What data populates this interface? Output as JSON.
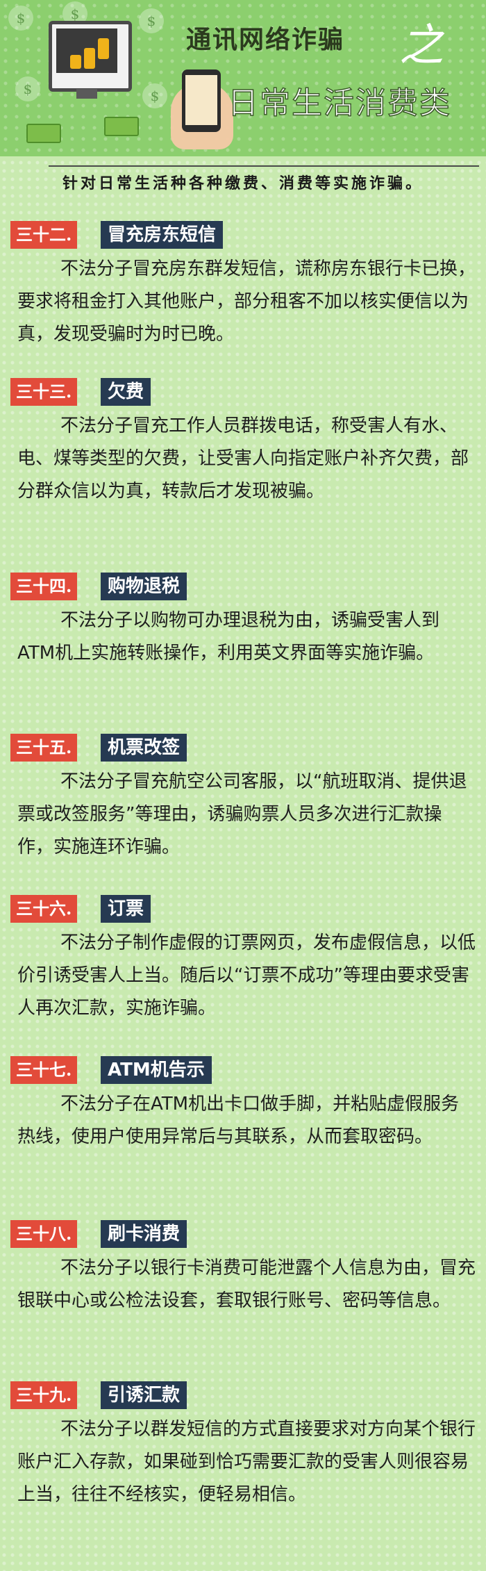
{
  "header": {
    "title_line1": "通讯网络诈骗",
    "title_zhi": "之",
    "title_line2": "日常生活消费类"
  },
  "subtitle": "针对日常生活种各种缴费、消费等实施诈骗。",
  "sections": [
    {
      "num": "三十二.",
      "title": "冒充房东短信",
      "body": "不法分子冒充房东群发短信，谎称房东银行卡已换，要求将租金打入其他账户，部分租客不加以核实便信以为真，发现受骗时为时已晚。"
    },
    {
      "num": "三十三.",
      "title": "欠费",
      "body": "不法分子冒充工作人员群拨电话，称受害人有水、电、煤等类型的欠费，让受害人向指定账户补齐欠费，部分群众信以为真，转款后才发现被骗。"
    },
    {
      "num": "三十四.",
      "title": "购物退税",
      "body": "不法分子以购物可办理退税为由，诱骗受害人到ATM机上实施转账操作，利用英文界面等实施诈骗。"
    },
    {
      "num": "三十五.",
      "title": "机票改签",
      "body": "不法分子冒充航空公司客服，以“航班取消、提供退票或改签服务”等理由，诱骗购票人员多次进行汇款操作，实施连环诈骗。"
    },
    {
      "num": "三十六.",
      "title": "订票",
      "body": "不法分子制作虚假的订票网页，发布虚假信息，以低价引诱受害人上当。随后以“订票不成功”等理由要求受害人再次汇款，实施诈骗。"
    },
    {
      "num": "三十七.",
      "title": "ATM机告示",
      "body": "不法分子在ATM机出卡口做手脚，并粘贴虚假服务热线，使用户使用异常后与其联系，从而套取密码。"
    },
    {
      "num": "三十八.",
      "title": "刷卡消费",
      "body": "不法分子以银行卡消费可能泄露个人信息为由，冒充银联中心或公检法设套，套取银行账号、密码等信息。"
    },
    {
      "num": "三十九.",
      "title": "引诱汇款",
      "body": "不法分子以群发短信的方式直接要求对方向某个银行账户汇入存款，如果碰到恰巧需要汇款的受害人则很容易上当，往往不经核实，便轻易相信。"
    }
  ]
}
